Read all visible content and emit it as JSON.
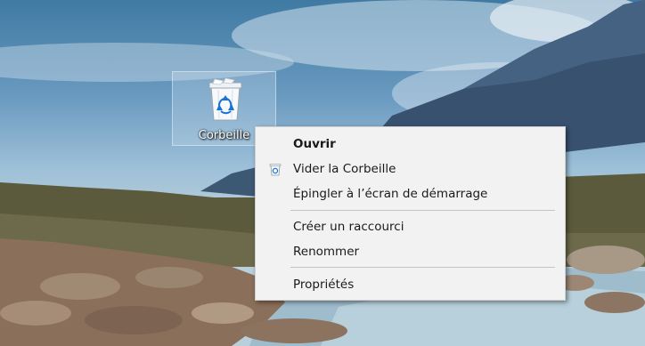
{
  "desktop": {
    "icon": {
      "name": "recycle-bin-icon",
      "label": "Corbeille"
    }
  },
  "context_menu": {
    "items": [
      {
        "label": "Ouvrir",
        "bold": true
      },
      {
        "label": "Vider la Corbeille",
        "icon": "recycle-bin-small-icon"
      },
      {
        "label": "Épingler à l’écran de démarrage"
      },
      {
        "label": "Créer un raccourci"
      },
      {
        "label": "Renommer"
      },
      {
        "label": "Propriétés"
      }
    ]
  },
  "colors": {
    "menu_background": "#f2f2f2",
    "menu_border": "#cfcfcf",
    "separator": "#c4c4c4",
    "selection_fill": "#d2e1f0"
  }
}
